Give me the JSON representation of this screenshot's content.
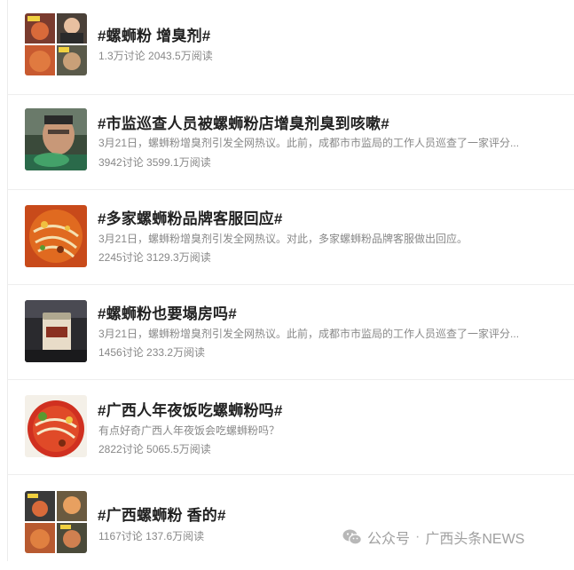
{
  "topics": [
    {
      "title": "#螺蛳粉 增臭剂#",
      "description": "",
      "stats": "1.3万讨论 2043.5万阅读",
      "thumb_icon": "snail-noodle-collage-icon"
    },
    {
      "title": "#市监巡查人员被螺蛳粉店增臭剂臭到咳嗽#",
      "description": "3月21日，螺蛳粉增臭剂引发全网热议。此前，成都市市监局的工作人员巡查了一家评分...",
      "stats": "3942讨论 3599.1万阅读",
      "thumb_icon": "man-coughing-photo-icon"
    },
    {
      "title": "#多家螺蛳粉品牌客服回应#",
      "description": "3月21日，螺蛳粉增臭剂引发全网热议。对此，多家螺蛳粉品牌客服做出回应。",
      "stats": "2245讨论 3129.3万阅读",
      "thumb_icon": "noodle-bowl-photo-icon"
    },
    {
      "title": "#螺蛳粉也要塌房吗#",
      "description": "3月21日，螺蛳粉增臭剂引发全网热议。此前，成都市市监局的工作人员巡查了一家评分...",
      "stats": "1456讨论 233.2万阅读",
      "thumb_icon": "seasoning-jar-photo-icon"
    },
    {
      "title": "#广西人年夜饭吃螺蛳粉吗#",
      "description": "有点好奇广西人年夜饭会吃螺蛳粉吗？",
      "stats": "2822讨论 5065.5万阅读",
      "thumb_icon": "noodle-bowl-red-photo-icon"
    },
    {
      "title": "#广西螺蛳粉 香的#",
      "description": "",
      "stats": "1167讨论 137.6万阅读",
      "thumb_icon": "snail-noodle-collage-icon"
    }
  ],
  "watermark": {
    "prefix": "公众号",
    "separator": "·",
    "account": "广西头条NEWS",
    "icon": "wechat-icon"
  }
}
